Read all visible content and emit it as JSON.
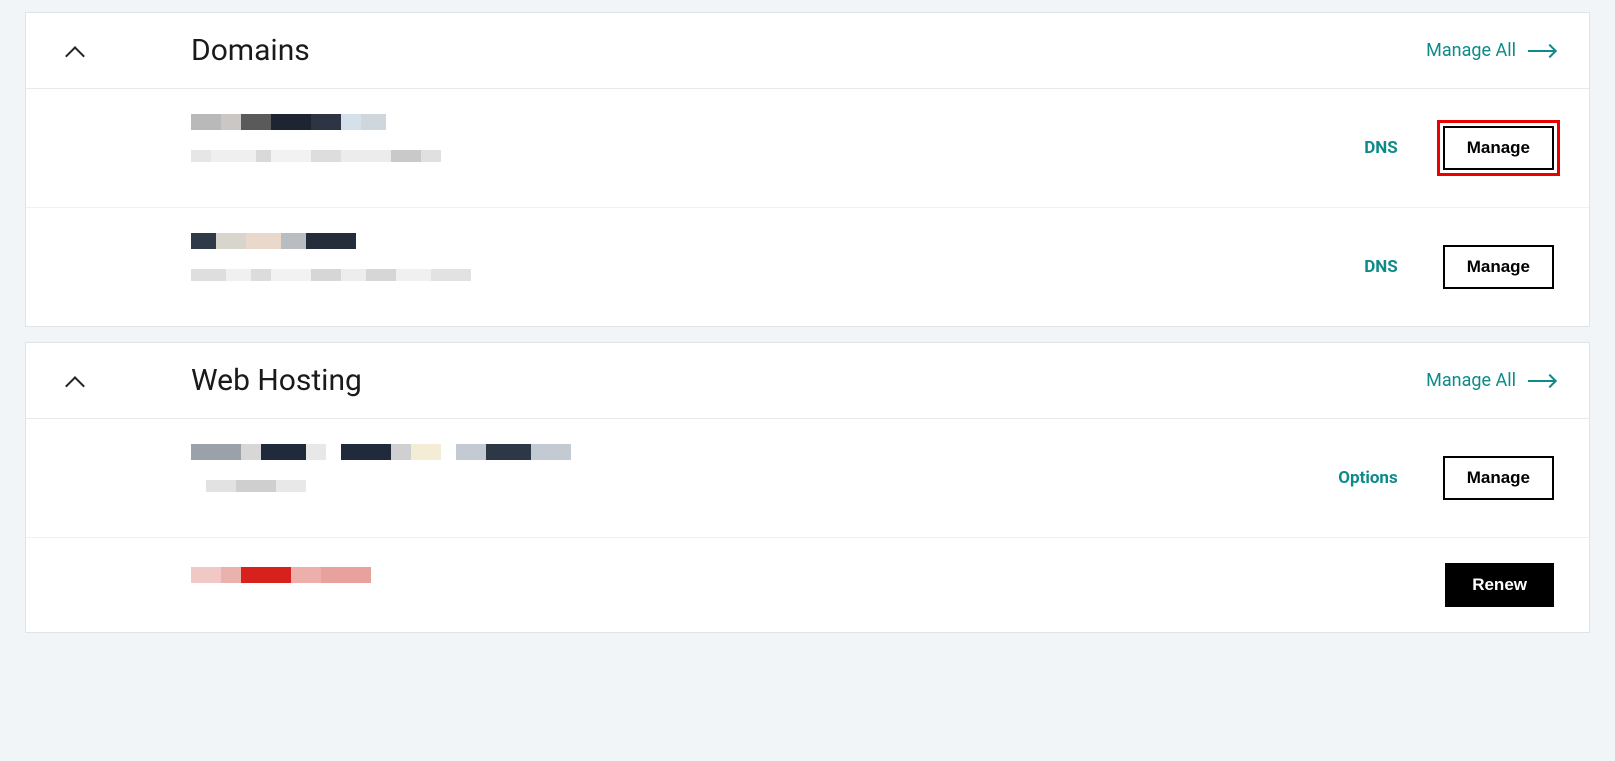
{
  "colors": {
    "accent": "#0e8a8a",
    "highlight": "#e90000"
  },
  "sections": {
    "domains": {
      "title": "Domains",
      "manage_all_label": "Manage All",
      "items": [
        {
          "dns_label": "DNS",
          "manage_label": "Manage",
          "highlighted": true
        },
        {
          "dns_label": "DNS",
          "manage_label": "Manage",
          "highlighted": false
        }
      ]
    },
    "web_hosting": {
      "title": "Web Hosting",
      "manage_all_label": "Manage All",
      "items": [
        {
          "options_label": "Options",
          "manage_label": "Manage"
        },
        {
          "renew_label": "Renew"
        }
      ]
    }
  }
}
